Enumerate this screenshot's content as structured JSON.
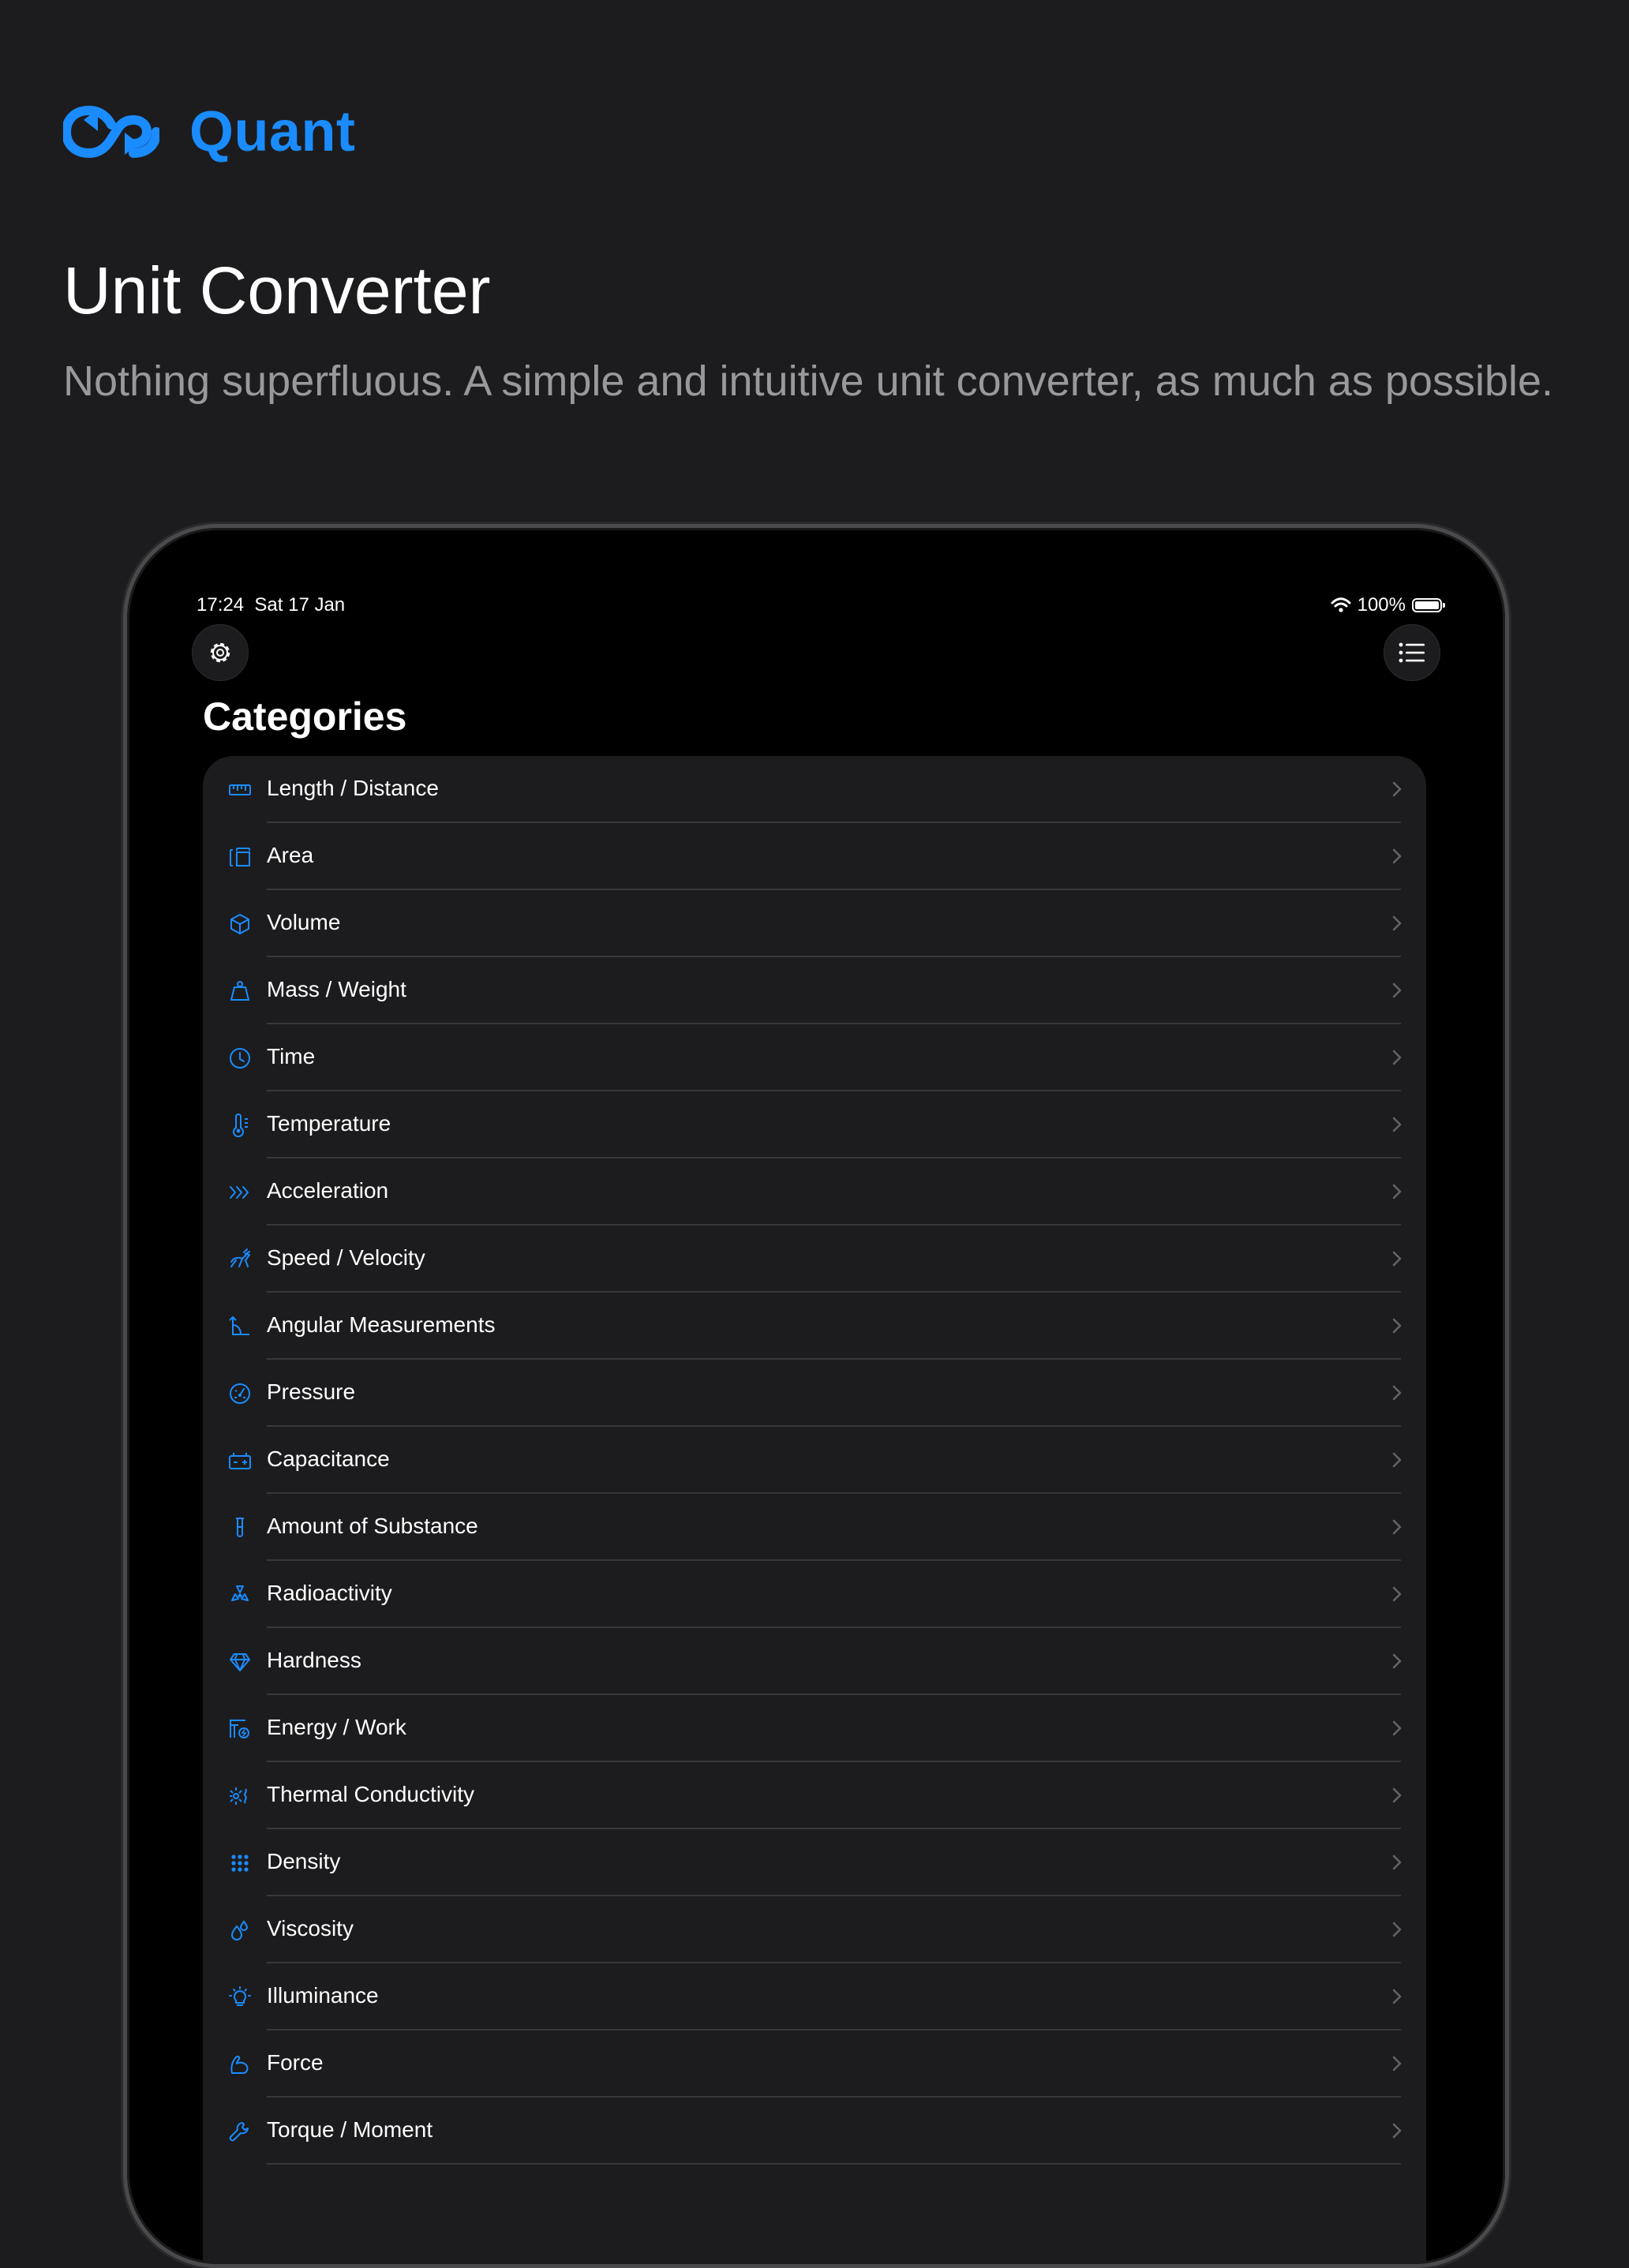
{
  "brand": {
    "name": "Quant",
    "logo_icon": "infinity-arrows-icon",
    "accent": "#1a8cff"
  },
  "marketing": {
    "headline": "Unit Converter",
    "tagline": "Nothing superfluous. A simple and intuitive unit converter, as much as possible."
  },
  "status_bar": {
    "time": "17:24",
    "date": "Sat 17 Jan",
    "battery": "100%",
    "battery_level": 1.0,
    "wifi_icon": "wifi-icon"
  },
  "toolbar": {
    "left_icon": "gear-icon",
    "right_icon": "list-icon"
  },
  "categories": {
    "title": "Categories",
    "items": [
      {
        "label": "Length / Distance",
        "icon": "ruler-icon"
      },
      {
        "label": "Area",
        "icon": "area-icon"
      },
      {
        "label": "Volume",
        "icon": "cube-icon"
      },
      {
        "label": "Mass / Weight",
        "icon": "scale-weight-icon"
      },
      {
        "label": "Time",
        "icon": "clock-icon"
      },
      {
        "label": "Temperature",
        "icon": "thermometer-icon"
      },
      {
        "label": "Acceleration",
        "icon": "chevrons-right-icon"
      },
      {
        "label": "Speed / Velocity",
        "icon": "gazelle-icon"
      },
      {
        "label": "Angular Measurements",
        "icon": "angle-icon"
      },
      {
        "label": "Pressure",
        "icon": "gauge-icon"
      },
      {
        "label": "Capacitance",
        "icon": "battery-block-icon"
      },
      {
        "label": "Amount of Substance",
        "icon": "test-tube-icon"
      },
      {
        "label": "Radioactivity",
        "icon": "radiation-icon"
      },
      {
        "label": "Hardness",
        "icon": "diamond-icon"
      },
      {
        "label": "Energy / Work",
        "icon": "energy-icon"
      },
      {
        "label": "Thermal Conductivity",
        "icon": "heat-waves-icon"
      },
      {
        "label": "Density",
        "icon": "dots-grid-icon"
      },
      {
        "label": "Viscosity",
        "icon": "drops-icon"
      },
      {
        "label": "Illuminance",
        "icon": "light-bulb-icon"
      },
      {
        "label": "Force",
        "icon": "muscle-icon"
      },
      {
        "label": "Torque / Moment",
        "icon": "wrench-icon"
      }
    ]
  }
}
